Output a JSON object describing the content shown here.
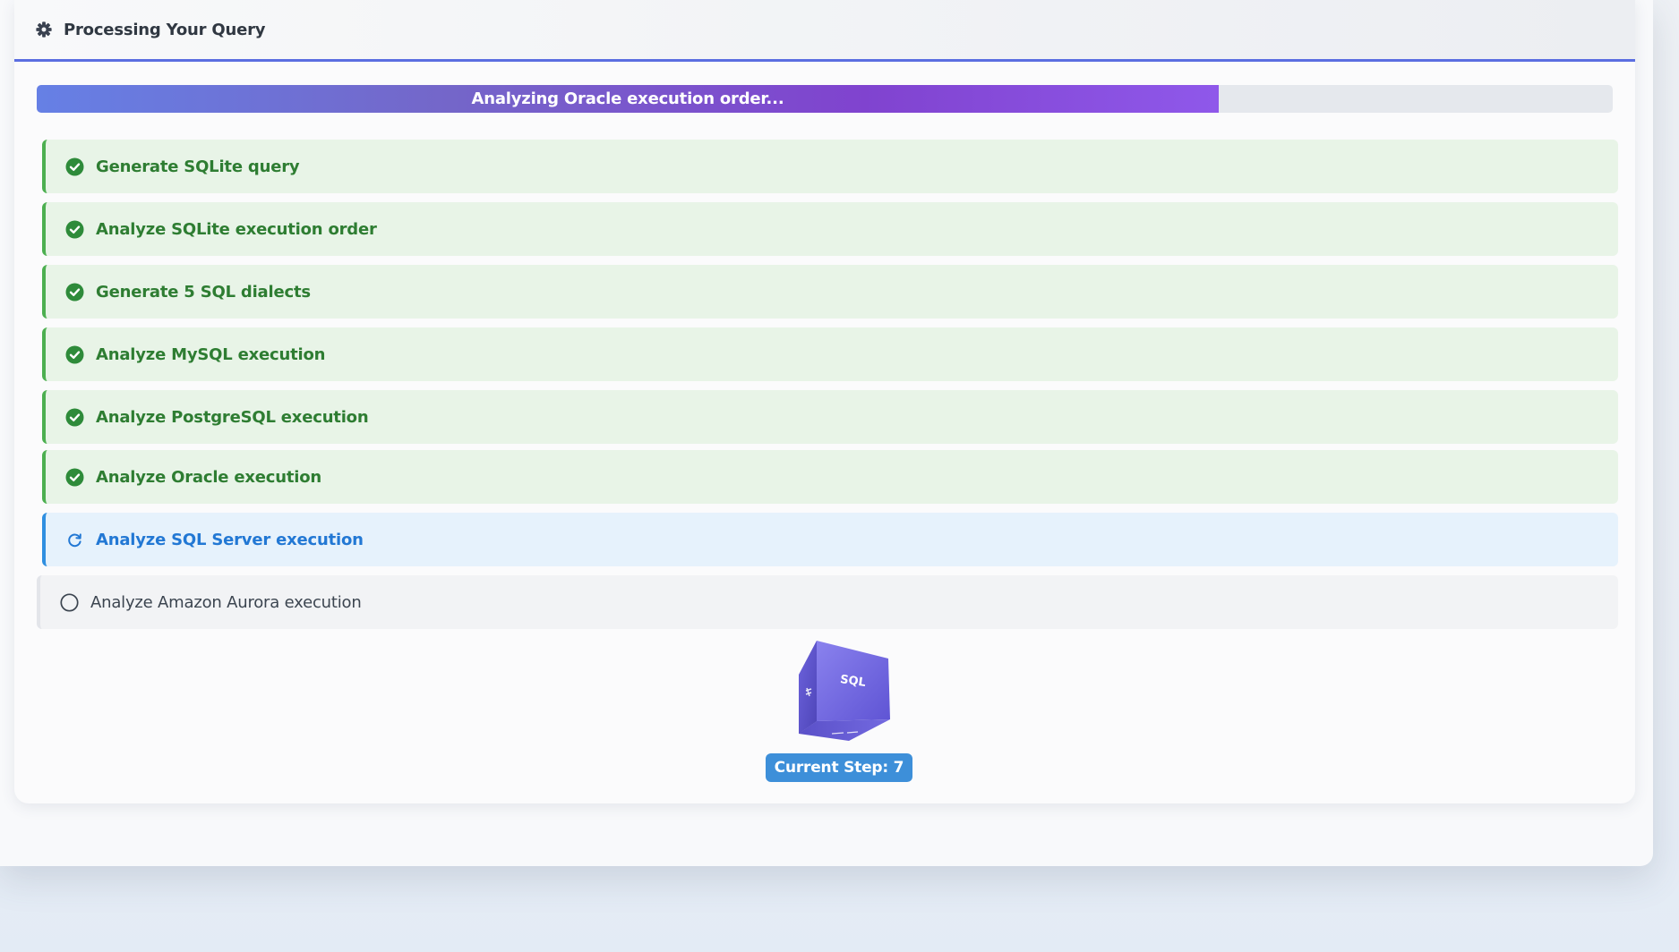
{
  "header": {
    "title": "Processing Your Query",
    "icon": "gear-icon"
  },
  "progress": {
    "label": "Analyzing Oracle execution order...",
    "percent": 75,
    "fill_start_color": "#6680e5",
    "fill_end_color": "#8f58ea"
  },
  "steps": [
    {
      "label": "Generate SQLite query",
      "status": "complete"
    },
    {
      "label": "Analyze SQLite execution order",
      "status": "complete"
    },
    {
      "label": "Generate 5 SQL dialects",
      "status": "complete"
    },
    {
      "label": "Analyze MySQL execution",
      "status": "complete"
    },
    {
      "label": "Analyze PostgreSQL execution",
      "status": "complete"
    },
    {
      "label": "Analyze Oracle execution",
      "status": "complete"
    },
    {
      "label": "Analyze SQL Server execution",
      "status": "active"
    },
    {
      "label": "Analyze Amazon Aurora execution",
      "status": "pending"
    }
  ],
  "colors": {
    "complete": "#2e7d32",
    "complete_icon": "#2e8b3a",
    "active": "#2278d4",
    "pending_icon": "#3c4550",
    "accent": "#5b6ee1"
  },
  "cube": {
    "icon": "sql-cube-icon",
    "face_label": "SQL"
  },
  "current_step": {
    "label": "Current Step: 7"
  }
}
